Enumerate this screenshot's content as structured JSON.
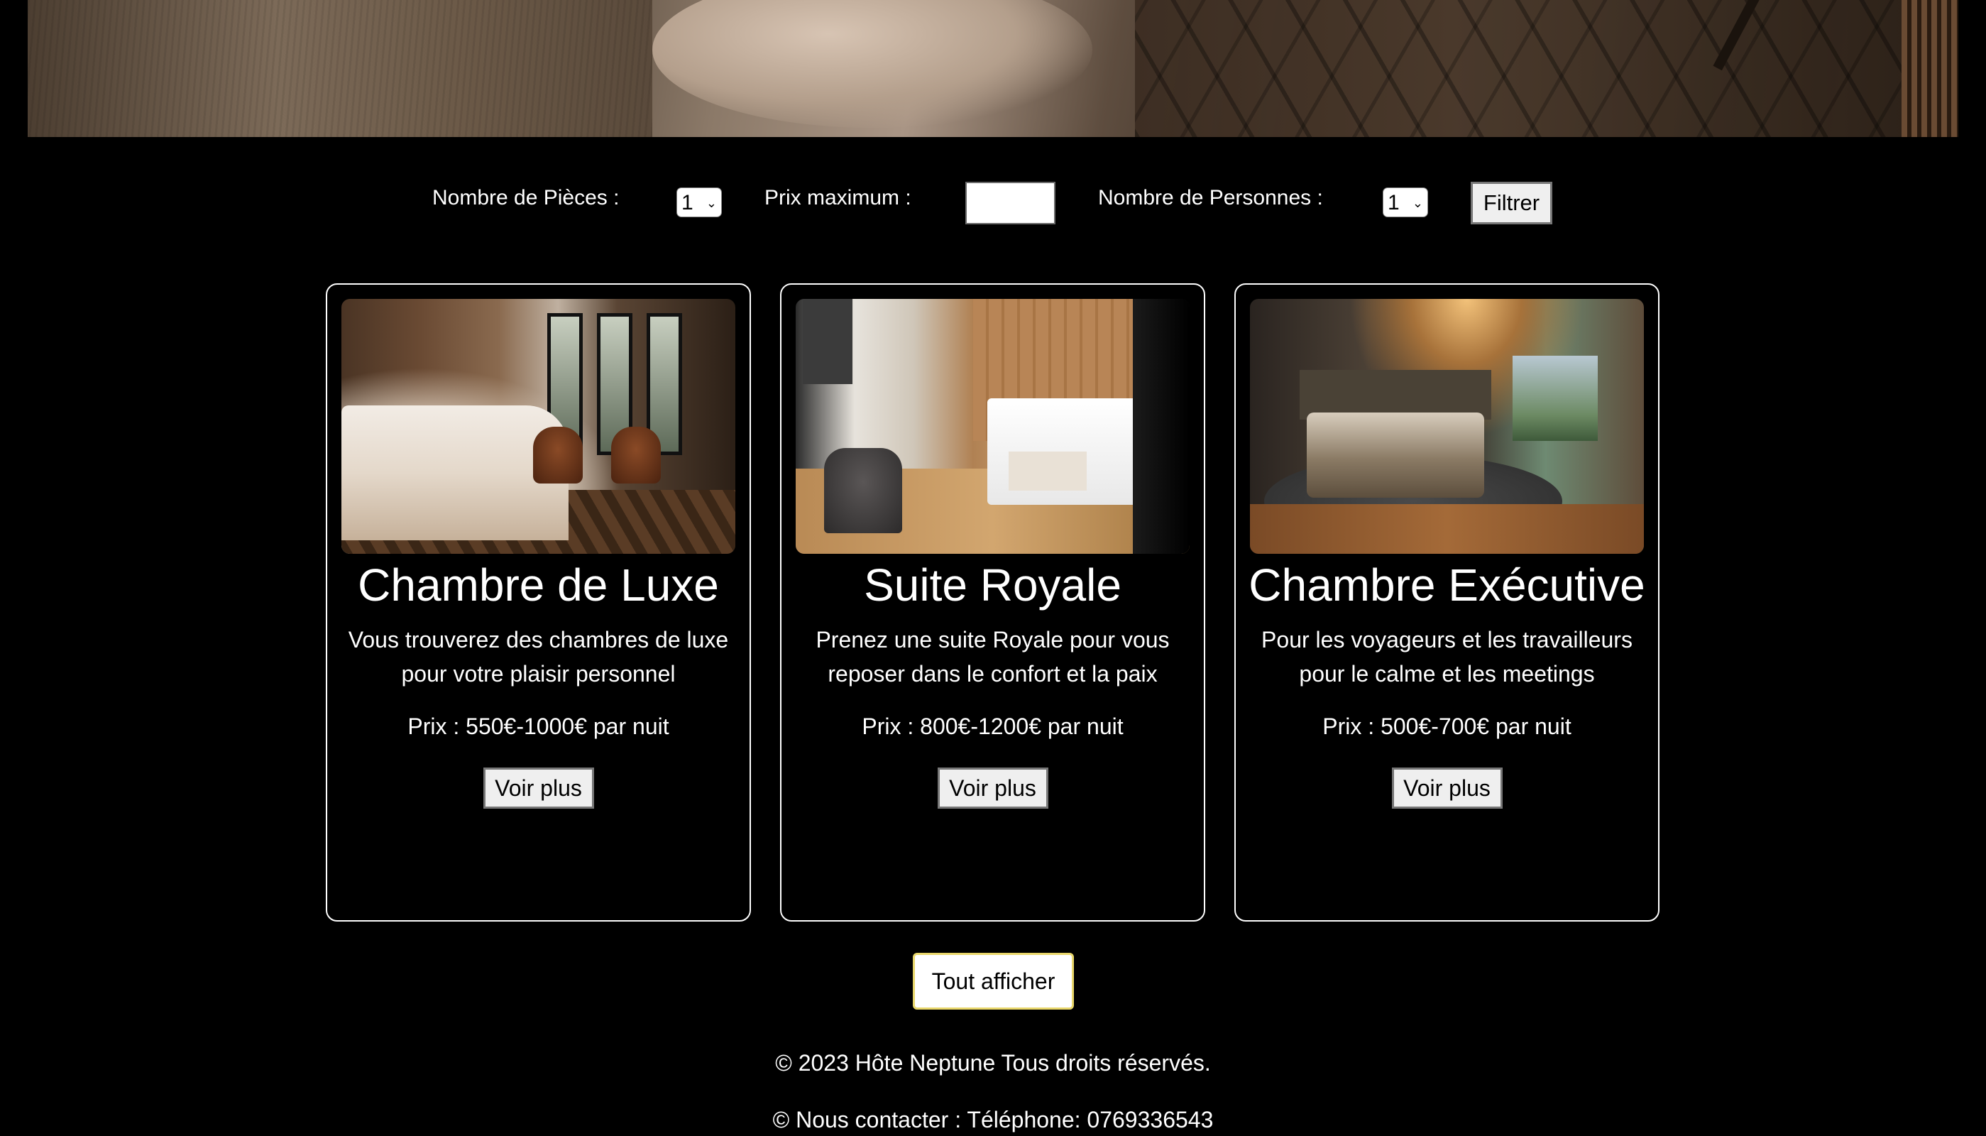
{
  "filters": {
    "rooms_label": "Nombre de Pièces :",
    "rooms_value": "1",
    "price_label": "Prix maximum :",
    "price_value": "",
    "persons_label": "Nombre de Personnes :",
    "persons_value": "1",
    "filter_button": "Filtrer"
  },
  "cards": [
    {
      "title": "Chambre de Luxe",
      "description": "Vous trouverez des chambres de luxe pour votre plaisir personnel",
      "price": "Prix : 550€-1000€ par nuit",
      "button": "Voir plus"
    },
    {
      "title": "Suite Royale",
      "description": "Prenez une suite Royale pour vous reposer dans le confort et la paix",
      "price": "Prix : 800€-1200€ par nuit",
      "button": "Voir plus"
    },
    {
      "title": "Chambre Exécutive",
      "description": "Pour les voyageurs et les travailleurs pour le calme et les meetings",
      "price": "Prix : 500€-700€ par nuit",
      "button": "Voir plus"
    }
  ],
  "show_all_button": "Tout afficher",
  "footer": {
    "copyright": "© 2023 Hôte Neptune Tous droits réservés.",
    "contact": "© Nous contacter : Téléphone: 0769336543"
  },
  "colors": {
    "background": "#000000",
    "card_border": "#ffffff",
    "show_all_border": "#e8d66a"
  }
}
